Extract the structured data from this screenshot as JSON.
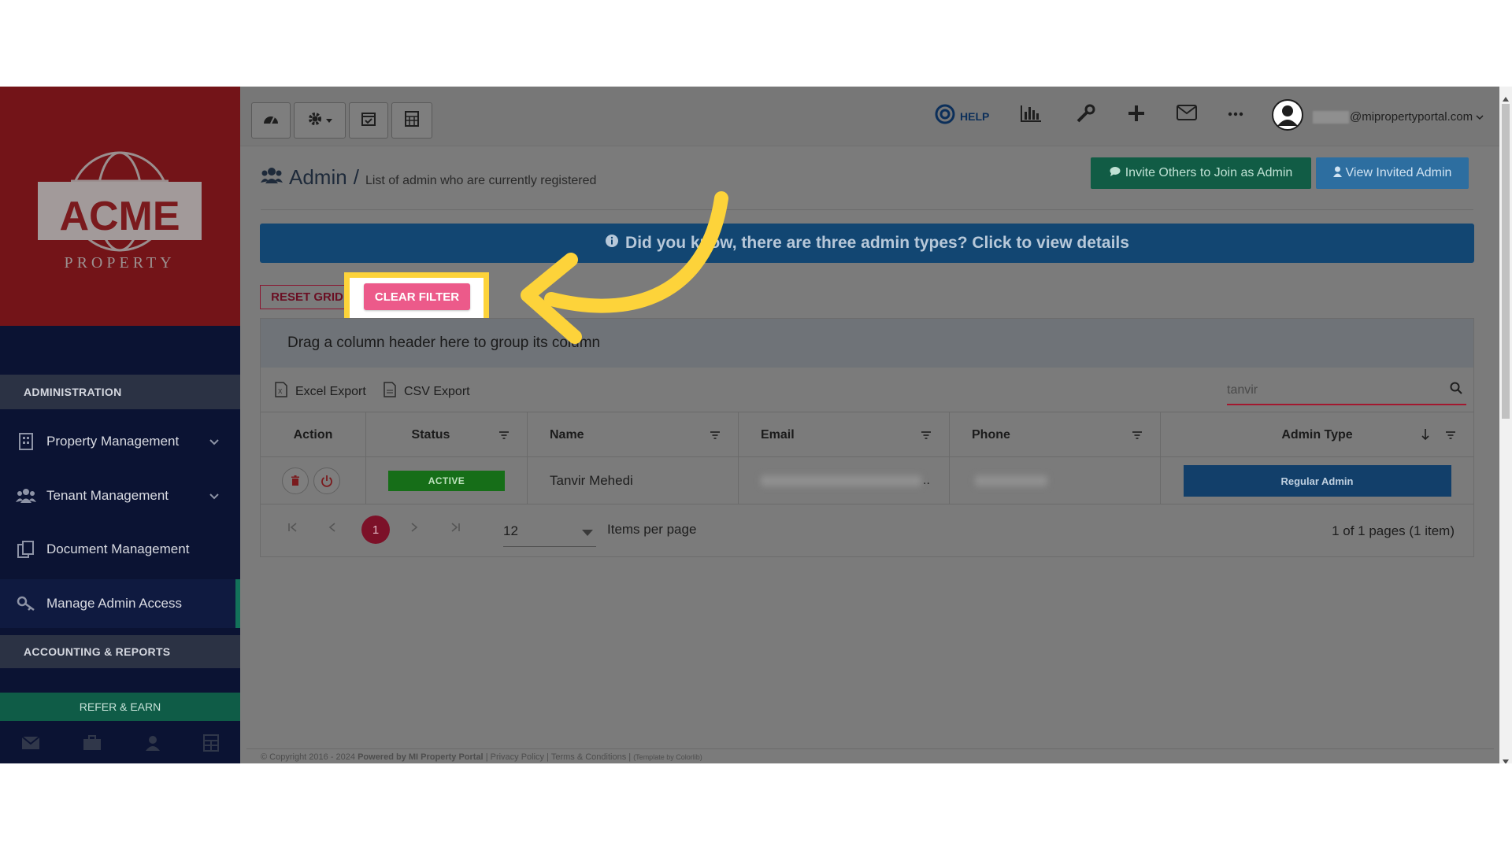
{
  "sidebar": {
    "logo_text": "ACME",
    "logo_sub": "PROPERTY",
    "section_admin": "ADMINISTRATION",
    "items": [
      {
        "label": "Property Management"
      },
      {
        "label": "Tenant Management"
      },
      {
        "label": "Document Management"
      },
      {
        "label": "Manage Admin Access"
      }
    ],
    "section_accounting": "ACCOUNTING & REPORTS",
    "refer_label": "REFER & EARN"
  },
  "topbar": {
    "help_label": "HELP",
    "user_email": "@mipropertyportal.com"
  },
  "page": {
    "title": "Admin",
    "separator": "/",
    "subtitle": "List of admin who are currently registered",
    "invite_button": "Invite Others to Join as Admin",
    "view_invited_button": "View Invited Admin",
    "info_banner": "Did you know, there are three admin types? Click to view details"
  },
  "grid": {
    "reset_grid": "RESET GRID",
    "clear_filter": "CLEAR FILTER",
    "group_panel": "Drag a column header here to group its column",
    "excel_export": "Excel Export",
    "csv_export": "CSV Export",
    "search_value": "tanvir",
    "columns": [
      "Action",
      "Status",
      "Name",
      "Email",
      "Phone",
      "Admin Type"
    ],
    "row": {
      "status": "ACTIVE",
      "name": "Tanvir Mehedi",
      "email_suffix": "..",
      "admin_type": "Regular Admin"
    },
    "pager": {
      "current_page": "1",
      "per_page": "12",
      "items_per_page_label": "Items per page",
      "page_info": "1 of 1 pages (1 item)"
    }
  },
  "footer": {
    "copyright": "© Copyright 2016 - 2024",
    "powered": "Powered by MI Property Portal",
    "links": "| Privacy Policy | Terms & Conditions |",
    "template": "(Template by Colorlib)"
  },
  "colors": {
    "highlight": "#fdd33a",
    "arrow": "#fdd33a",
    "clear_filter": "#ec5a8a"
  }
}
